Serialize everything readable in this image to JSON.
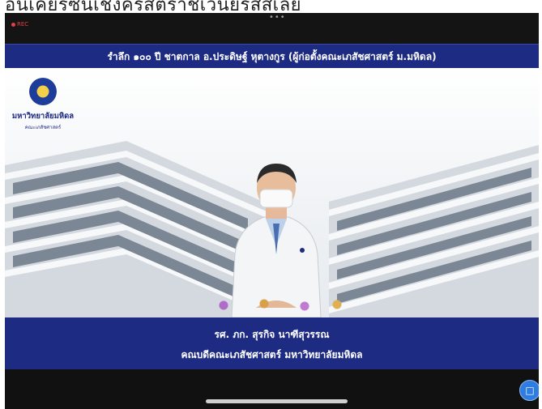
{
  "top_caption": "อีนีเคียร์ซีนีเชิงคริสต์ราชีเวนีย์รัสสเลีย",
  "topbar": {
    "rec_label": "REC",
    "more_glyph": "•••"
  },
  "title_banner": "รำลึก ๑๐๐ ปี ชาตกาล อ.ประดิษฐ์ หุตางกูร (ผู้ก่อตั้งคณะเภสัชศาสตร์ ม.มหิดล)",
  "logo": {
    "university": "มหาวิทยาลัยมหิดล",
    "faculty": "คณะเภสัชศาสตร์"
  },
  "name_banner": {
    "line1": "รศ. ภก. สุรกิจ นาฑีสุวรรณ",
    "line2": "คณบดีคณะเภสัชศาสตร์ มหาวิทยาลัยมหิดล"
  },
  "colors": {
    "banner": "#1d2b83",
    "chat_button": "#2f7de1"
  },
  "icons": {
    "chat": "chat-bubble-icon",
    "seal": "university-seal-icon"
  }
}
